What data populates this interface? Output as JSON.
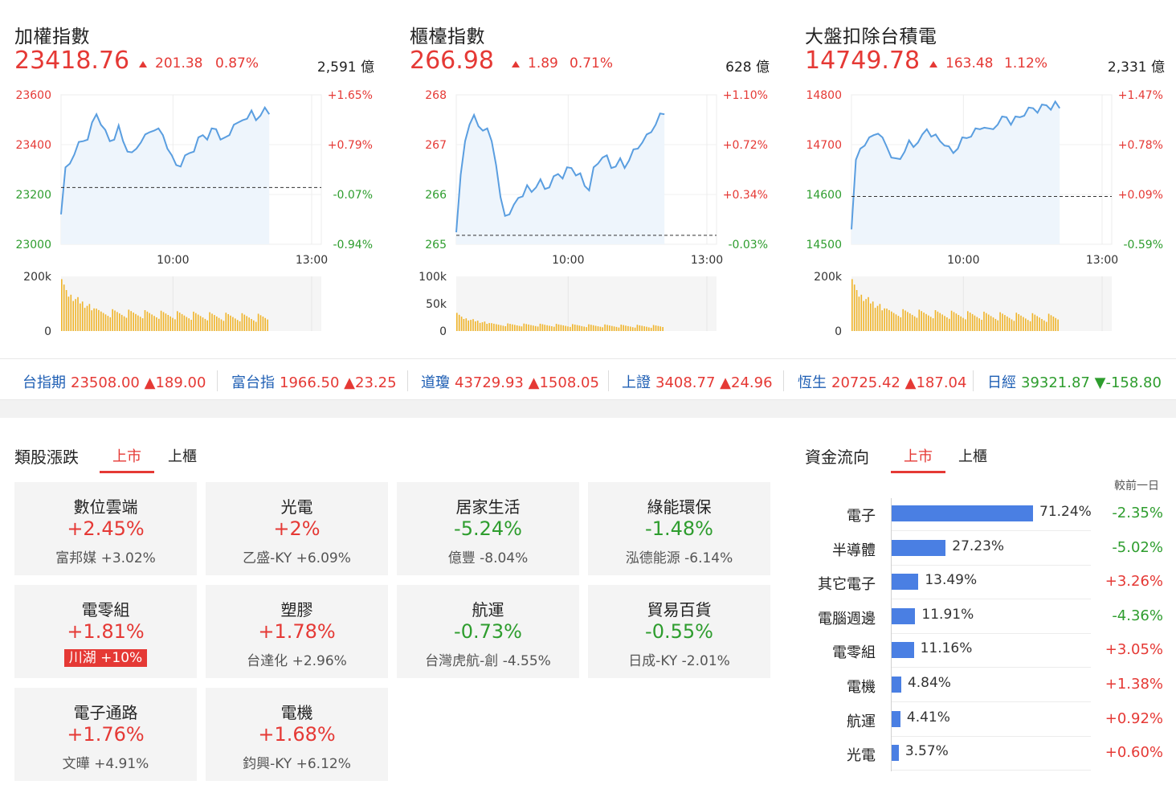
{
  "indices": [
    {
      "title": "加權指數",
      "price": "23418.76",
      "change": "201.38",
      "pct": "0.87%",
      "volume": "2,591 億",
      "y_labels": [
        "23600",
        "23400",
        "23200",
        "23000"
      ],
      "pct_labels": [
        "+1.65%",
        "+0.79%",
        "-0.07%",
        "-0.94%"
      ],
      "vol_labels": [
        "200k",
        "0"
      ],
      "time_labels": [
        "10:00",
        "13:00"
      ]
    },
    {
      "title": "櫃檯指數",
      "price": "266.98",
      "change": "1.89",
      "pct": "0.71%",
      "volume": "628 億",
      "y_labels": [
        "268",
        "267",
        "266",
        "265"
      ],
      "pct_labels": [
        "+1.10%",
        "+0.72%",
        "+0.34%",
        "-0.03%"
      ],
      "vol_labels": [
        "100k",
        "50k",
        "0"
      ],
      "time_labels": [
        "10:00",
        "13:00"
      ]
    },
    {
      "title": "大盤扣除台積電",
      "price": "14749.78",
      "change": "163.48",
      "pct": "1.12%",
      "volume": "2,331 億",
      "y_labels": [
        "14800",
        "14700",
        "14600",
        "14500"
      ],
      "pct_labels": [
        "+1.47%",
        "+0.78%",
        "+0.09%",
        "-0.59%"
      ],
      "vol_labels": [
        "200k",
        "0"
      ],
      "time_labels": [
        "10:00",
        "13:00"
      ]
    }
  ],
  "ticker": [
    {
      "name": "台指期",
      "value": "23508.00",
      "change": "▲189.00",
      "dir": "up"
    },
    {
      "name": "富台指",
      "value": "1966.50",
      "change": "▲23.25",
      "dir": "up"
    },
    {
      "name": "道瓊",
      "value": "43729.93",
      "change": "▲1508.05",
      "dir": "up"
    },
    {
      "name": "上證",
      "value": "3408.77",
      "change": "▲24.96",
      "dir": "up"
    },
    {
      "name": "恆生",
      "value": "20725.42",
      "change": "▲187.04",
      "dir": "up"
    },
    {
      "name": "日經",
      "value": "39321.87",
      "change": "▼-158.80",
      "dir": "down"
    }
  ],
  "sectors": {
    "title": "類股漲跌",
    "tabs": [
      "上市",
      "上櫃"
    ],
    "cards": [
      {
        "name": "數位雲端",
        "pct": "+2.45%",
        "dir": "up",
        "sub": "富邦媒  +3.02%"
      },
      {
        "name": "光電",
        "pct": "+2%",
        "dir": "up",
        "sub": "乙盛-KY  +6.09%"
      },
      {
        "name": "居家生活",
        "pct": "-5.24%",
        "dir": "down",
        "sub": "億豐  -8.04%"
      },
      {
        "name": "綠能環保",
        "pct": "-1.48%",
        "dir": "down",
        "sub": "泓德能源  -6.14%"
      },
      {
        "name": "電零組",
        "pct": "+1.81%",
        "dir": "up",
        "sub": "川湖  +10%",
        "badge": true
      },
      {
        "name": "塑膠",
        "pct": "+1.78%",
        "dir": "up",
        "sub": "台達化  +2.96%"
      },
      {
        "name": "航運",
        "pct": "-0.73%",
        "dir": "down",
        "sub": "台灣虎航-創  -4.55%"
      },
      {
        "name": "貿易百貨",
        "pct": "-0.55%",
        "dir": "down",
        "sub": "日成-KY  -2.01%"
      },
      {
        "name": "電子通路",
        "pct": "+1.76%",
        "dir": "up",
        "sub": "文曄  +4.91%"
      },
      {
        "name": "電機",
        "pct": "+1.68%",
        "dir": "up",
        "sub": "鈞興-KY  +6.12%"
      }
    ]
  },
  "fund_flow": {
    "title": "資金流向",
    "tabs": [
      "上市",
      "上櫃"
    ],
    "caption": "較前一日",
    "rows": [
      {
        "label": "電子",
        "share": 71.24,
        "value": "71.24%",
        "diff": "-2.35%",
        "dir": "down"
      },
      {
        "label": "半導體",
        "share": 27.23,
        "value": "27.23%",
        "diff": "-5.02%",
        "dir": "down"
      },
      {
        "label": "其它電子",
        "share": 13.49,
        "value": "13.49%",
        "diff": "+3.26%",
        "dir": "up"
      },
      {
        "label": "電腦週邊",
        "share": 11.91,
        "value": "11.91%",
        "diff": "-4.36%",
        "dir": "down"
      },
      {
        "label": "電零組",
        "share": 11.16,
        "value": "11.16%",
        "diff": "+3.05%",
        "dir": "up"
      },
      {
        "label": "電機",
        "share": 4.84,
        "value": "4.84%",
        "diff": "+1.38%",
        "dir": "up"
      },
      {
        "label": "航運",
        "share": 4.41,
        "value": "4.41%",
        "diff": "+0.92%",
        "dir": "up"
      },
      {
        "label": "光電",
        "share": 3.57,
        "value": "3.57%",
        "diff": "+0.60%",
        "dir": "up"
      }
    ]
  },
  "colors": {
    "up": "#e53935",
    "down": "#2e9d2e",
    "line": "#5a9ee0",
    "area": "#eef5fc",
    "volume": "#f0b429",
    "bar": "#4a7fe3",
    "link": "#1f5fb4"
  }
}
